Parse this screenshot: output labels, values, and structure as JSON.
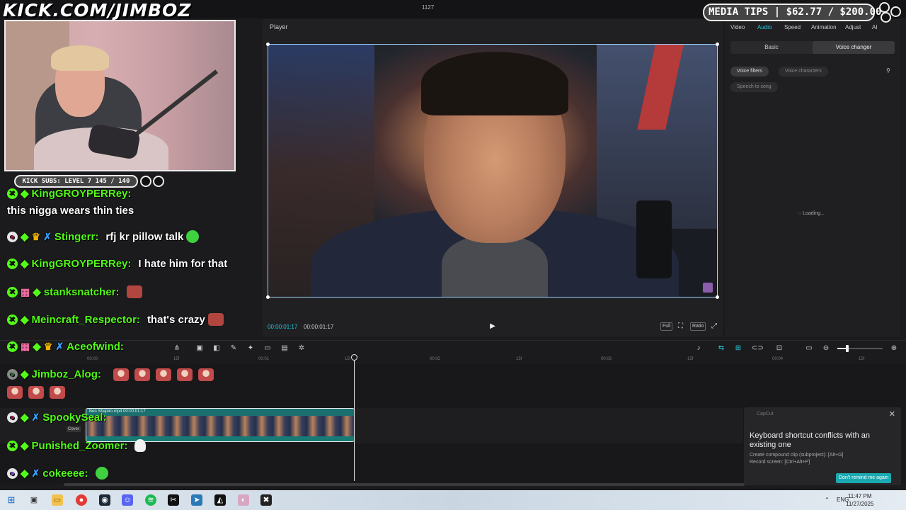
{
  "stream": {
    "url_text": "KICK.COM/JIMBOZ",
    "subs_text": "KICK SUBS: LEVEL 7 145 / 140",
    "media_tips": "MEDIA TIPS | $62.77 / $200.00"
  },
  "editor": {
    "frame_count": "1127",
    "player_title": "Player",
    "timecode_current": "00:00:01:17",
    "timecode_total": "00:00:01:17",
    "player_buttons": [
      "Full",
      "Ratio"
    ],
    "right_tabs": [
      "Video",
      "Audio",
      "Speed",
      "Animation",
      "Adjust",
      "AI"
    ],
    "active_tab": "Audio",
    "segments": [
      "Basic",
      "Voice changer"
    ],
    "chips": [
      "Voice filters",
      "Voice characters",
      "Speech to song"
    ],
    "loading": "Loading...",
    "ruler": [
      "00:00",
      "15f",
      "00:01",
      "15f",
      "00:02",
      "15f",
      "00:03",
      "15f",
      "00:04",
      "15f"
    ],
    "clip_label": "Ben Shapiro.mp4  00:00:01:17",
    "cover_label": "Cover",
    "zoom_level": 0.22
  },
  "toast": {
    "app": "CapCut",
    "title": "Keyboard shortcut conflicts with an existing one",
    "line1": "Create compound clip (subproject): [Alt+G]",
    "line2": "Record screen: [Ctrl+Alt+P]",
    "button": "Don't remind me again"
  },
  "chat": [
    {
      "user": "KingGROYPERRey:",
      "msg": ""
    },
    {
      "user": "",
      "msg": "this nigga wears thin ties"
    },
    {
      "user": "Stingerr:",
      "msg": "rfj kr pillow talk"
    },
    {
      "user": "KingGROYPERRey:",
      "msg": "I hate him for that"
    },
    {
      "user": "stanksnatcher:",
      "msg": ""
    },
    {
      "user": "Meincraft_Respector:",
      "msg": "that's crazy"
    },
    {
      "user": "Aceofwind:",
      "msg": ""
    },
    {
      "user": "Jimboz_Alog:",
      "msg": ""
    },
    {
      "user": "SpookySeal:",
      "msg": ""
    },
    {
      "user": "Punished_Zoomer:",
      "msg": ""
    },
    {
      "user": "cokeeee:",
      "msg": ""
    }
  ],
  "taskbar": {
    "lang": "ENG",
    "time": "11:47 PM",
    "date": "11/27/2025"
  }
}
